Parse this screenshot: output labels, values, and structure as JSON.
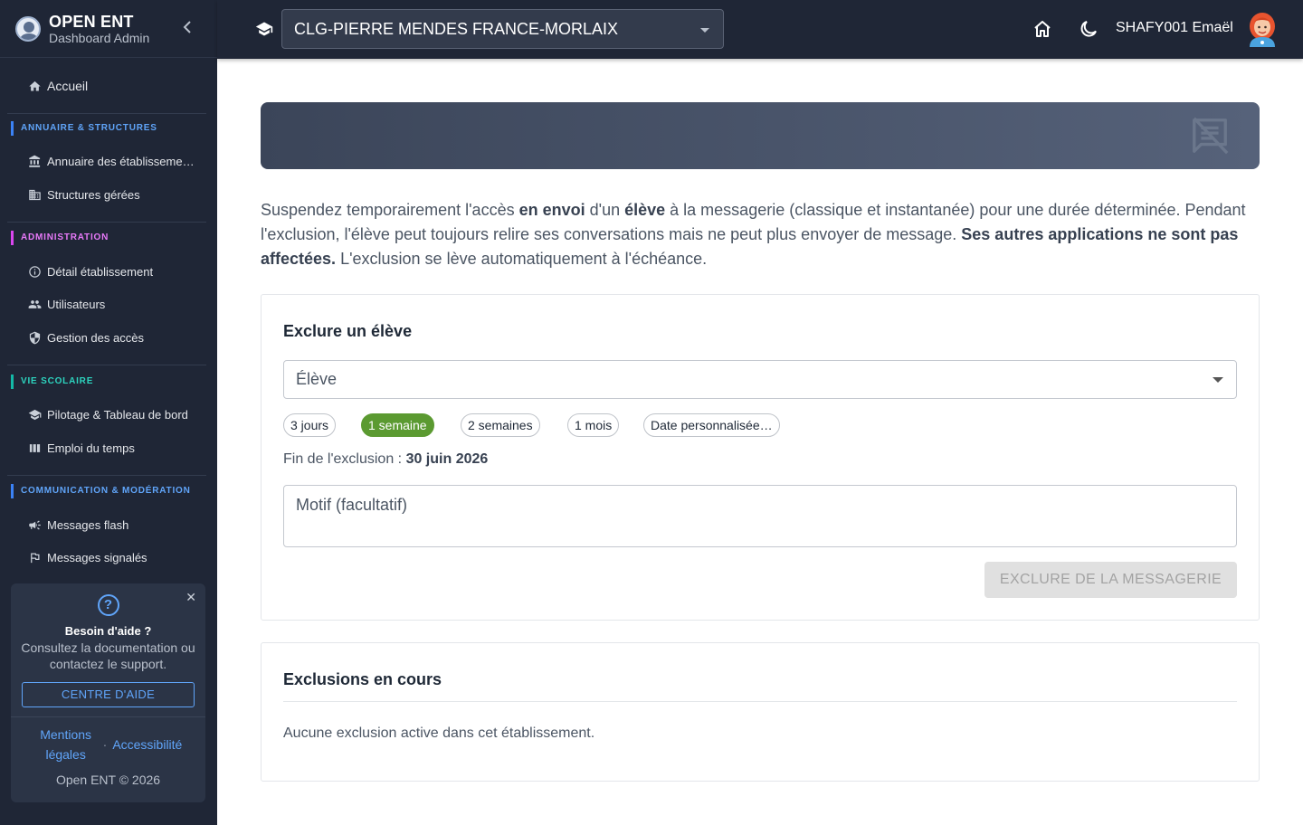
{
  "app": {
    "brand_title": "OPEN ENT",
    "brand_subtitle": "Dashboard Admin"
  },
  "sidebar": {
    "home": "Accueil",
    "sections": [
      {
        "title": "ANNUAIRE & STRUCTURES",
        "color": "#3b82f6",
        "items": [
          "Annuaire des établissements",
          "Structures gérées"
        ]
      },
      {
        "title": "ADMINISTRATION",
        "color": "#d946ef",
        "items": [
          "Détail établissement",
          "Utilisateurs",
          "Gestion des accès"
        ]
      },
      {
        "title": "VIE SCOLAIRE",
        "color": "#14b8a6",
        "items": [
          "Pilotage & Tableau de bord",
          "Emploi du temps"
        ]
      },
      {
        "title": "COMMUNICATION & MODÉRATION",
        "color": "#3b82f6",
        "items": [
          "Messages flash",
          "Messages signalés"
        ]
      }
    ],
    "help": {
      "title": "Besoin d'aide ?",
      "description": "Consultez la documentation ou contactez le support.",
      "button": "CENTRE D'AIDE",
      "link_legal": "Mentions légales",
      "separator": "·",
      "link_accessibility": "Accessibilité",
      "copyright": "Open ENT © 2026"
    }
  },
  "topbar": {
    "school": "CLG-PIERRE MENDES FRANCE-MORLAIX",
    "user": "SHAFY001 Emaël"
  },
  "main": {
    "intro_parts": {
      "p1": "Suspendez temporairement l'accès ",
      "b1": "en envoi",
      "p2": " d'un ",
      "b2": "élève",
      "p3": " à la messagerie (classique et instantanée) pour une durée déterminée. Pendant l'exclusion, l'élève peut toujours relire ses conversations mais ne peut plus envoyer de message. ",
      "b3": "Ses autres applications ne sont pas affectées.",
      "p4": " L'exclusion se lève automatiquement à l'échéance."
    },
    "exclude_card": {
      "title": "Exclure un élève",
      "student_placeholder": "Élève",
      "durations": [
        "3 jours",
        "1 semaine",
        "2 semaines",
        "1 mois",
        "Date personnalisée…"
      ],
      "active_duration": "1 semaine",
      "end_label": "Fin de l'exclusion : ",
      "end_value": "30 juin 2026",
      "reason_placeholder": "Motif (facultatif)",
      "submit": "EXCLURE DE LA MESSAGERIE"
    },
    "current_card": {
      "title": "Exclusions en cours",
      "empty": "Aucune exclusion active dans cet établissement."
    }
  },
  "colors": {
    "sidebar_bg": "#1f2636",
    "active_chip": "#5b9a31",
    "link": "#60a5fa"
  }
}
